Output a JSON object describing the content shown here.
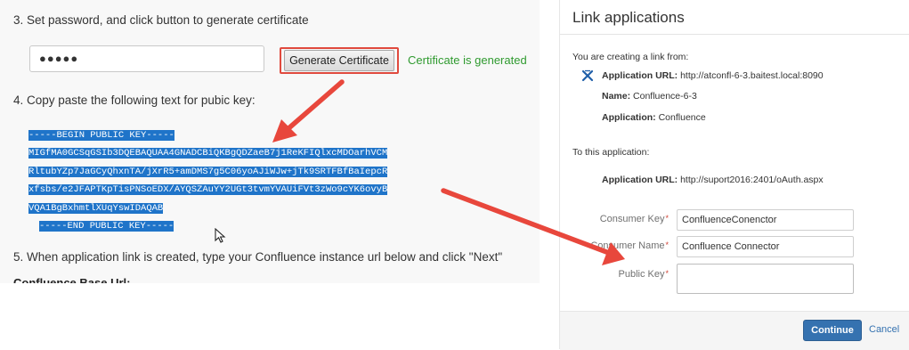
{
  "left": {
    "step3": "3. Set password, and click button to generate certificate",
    "password_value": "●●●●●",
    "generate_label": "Generate Certificate",
    "generate_status": "Certificate is generated",
    "step4": "4. Copy paste the following text for pubic key:",
    "key_lines": [
      "-----BEGIN PUBLIC KEY-----",
      "MIGfMA0GCSqGSIb3DQEBAQUAA4GNADCBiQKBgQDZaeB7j1ReKFIQlxcMDOarhVCM",
      "RltubYZp7JaGCyQhxnTA/jXrR5+amDMS7g5C06yoAJiWJw+jTk9SRTFBfBaIepcR",
      "xfsbs/e2JFAPTKpTisPNSoEDX/AYQSZAuYY2UGt3tvmYVAUiFVt3zWo9cYK6ovyB",
      "VQA1BgBxhmtlXUqYswIDAQAB",
      "-----END PUBLIC KEY-----"
    ],
    "step5": "5. When application link is created, type your Confluence instance url below and click \"Next\"",
    "base_url_label": "Confluence Base Url:"
  },
  "dialog": {
    "title": "Link applications",
    "from_heading": "You are creating a link from:",
    "from": {
      "app_url_label": "Application URL:",
      "app_url_value": "http://atconfl-6-3.baitest.local:8090",
      "name_label": "Name:",
      "name_value": "Confluence-6-3",
      "application_label": "Application:",
      "application_value": "Confluence"
    },
    "to_heading": "To this application:",
    "to": {
      "app_url_label": "Application URL:",
      "app_url_value": "http://suport2016:2401/oAuth.aspx"
    },
    "fields": {
      "consumer_key_label": "Consumer Key",
      "consumer_key_value": "ConfluenceConenctor",
      "consumer_name_label": "Consumer Name",
      "consumer_name_value": "Confluence Connector",
      "public_key_label": "Public Key",
      "public_key_value": ""
    },
    "continue_label": "Continue",
    "cancel_label": "Cancel"
  },
  "colors": {
    "arrow": "#e8473c",
    "highlight": "#1f74c9",
    "success": "#2f9a2f",
    "primary_button": "#3572b0",
    "required": "#d04437"
  },
  "icons": {
    "application_icon": "confluence-x-icon",
    "mouse_cursor": "cursor-arrow-icon"
  }
}
